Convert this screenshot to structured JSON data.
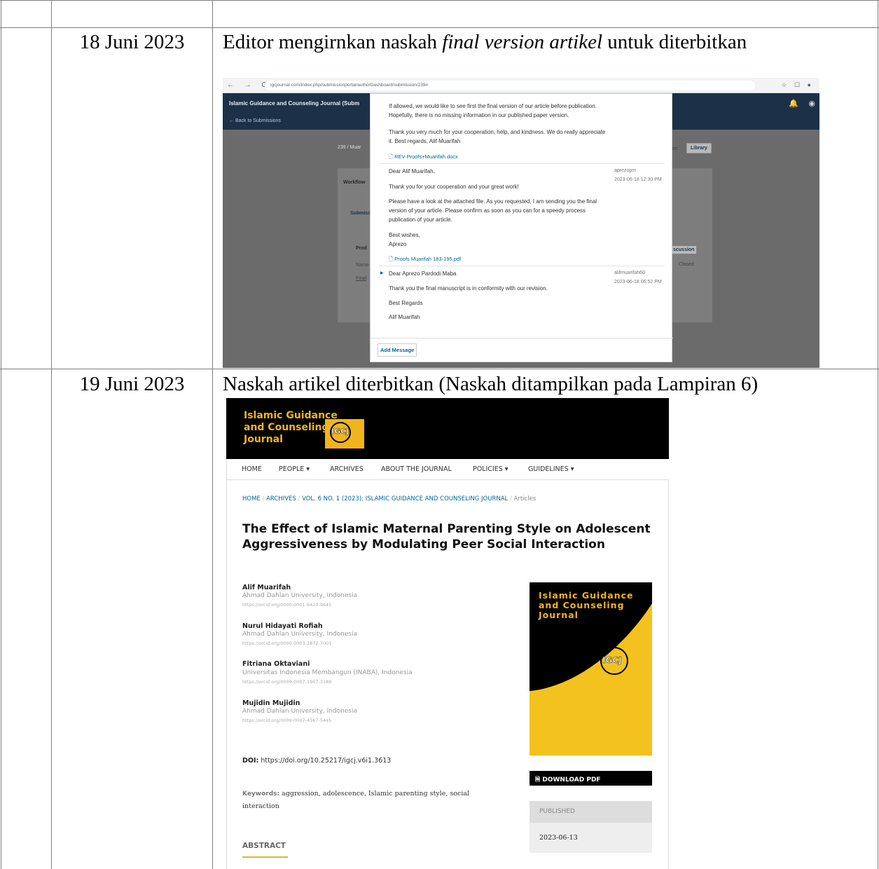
{
  "rows": [
    {
      "date": "18 Juni 2023",
      "desc_prefix": "Editor mengirnkan naskah ",
      "desc_italic": "final version artikel",
      "desc_suffix": " untuk diterbitkan"
    },
    {
      "date": "19 Juni 2023",
      "desc": "Naskah artikel diterbitkan (Naskah ditampilkan pada Lampiran 6)"
    }
  ],
  "screenshot1": {
    "browser": {
      "nav": "← → C",
      "url": "igcjournal.com/index.php/submissionportal/authorDashboard/submission/239#",
      "icons": "☆ ☐ ●"
    },
    "app_title": "Islamic Guidance and Counseling Journal (Subm",
    "back_link": "← Back to Submissions",
    "breadcrumb": "239 / Muar",
    "library_button": "Library",
    "background": {
      "workflow_tab": "Workflow",
      "submission_tab": "Submiss",
      "production_heading": "Prod",
      "name_col": "Name",
      "final_link": "Final",
      "discussion_button": "scussion",
      "closed_col": "Closed",
      "partial_word": "on"
    },
    "discussion": {
      "msg1_text": "If allowed, we would like to see first the final version of our article before publication. Hopefully, there is no missing information in our published paper version.",
      "msg1_thanks": "Thank you very much for your cooperation, help, and kindness. We do really appreciate it.   Best regards,   Alif Muarifah",
      "msg1_attachment": "REV Proofs+Muarifah.docx",
      "msg2_greeting": "Dear Alif Muarifah,",
      "msg2_line1": "Thank you for your cooperation and your great work!",
      "msg2_line2": "Please have a look at the attached file. As you requested, I am sending you the final version of your article. Please confirm as soon as you can for a speedy process publication of your article.",
      "msg2_closing": "Best wishes,",
      "msg2_name": "Aprezo",
      "msg2_attachment": "Proofs Muarifah 183-195.pdf",
      "msg2_author": "aprezopm",
      "msg2_date": "2023-06-18 12:30 PM",
      "msg3_greeting": "Dear Aprezo Pardodi Maba",
      "msg3_line1": "Thank you the final manuscript is in conformity with our revision.",
      "msg3_closing": "Best Regards",
      "msg3_name": "Alif Muarifah",
      "msg3_author": "alifmuarifah60",
      "msg3_date": "2023-06-18 06:52 PM",
      "add_message": "Add Message"
    }
  },
  "screenshot2": {
    "logo_text_1": "Islamic Guidance",
    "logo_text_2": "and Counseling",
    "logo_text_3": "Journal",
    "logo_badge": "IGCJ",
    "menu": [
      "HOME",
      "PEOPLE ▾",
      "ARCHIVES",
      "ABOUT THE JOURNAL",
      "POLICIES ▾",
      "GUIDELINES ▾"
    ],
    "breadcrumb": {
      "home": "HOME",
      "archives": "ARCHIVES",
      "issue": "VOL. 6 NO. 1 (2023): ISLAMIC GUIDANCE AND COUNSELING JOURNAL",
      "current": "Articles"
    },
    "title": "The Effect of Islamic Maternal Parenting Style on Adolescent Aggressiveness by Modulating Peer Social Interaction",
    "authors": [
      {
        "name": "Alif Muarifah",
        "affiliation": "Ahmad Dahlan University, Indonesia",
        "orcid": "https://orcid.org/0000-0001-6420-9645"
      },
      {
        "name": "Nurul Hidayati Rofiah",
        "affiliation": "Ahmad Dahlan University, Indonesia",
        "orcid": "https://orcid.org/0000-0003-2872-7001"
      },
      {
        "name": "Fitriana Oktaviani",
        "affiliation": "Universitas Indonesia Membangun (INABA), Indonesia",
        "orcid": "https://orcid.org/0009-0007-1907-3188"
      },
      {
        "name": "Mujidin Mujidin",
        "affiliation": "Ahmad Dahlan University, Indonesia",
        "orcid": "https://orcid.org/0009-0007-4367-5445"
      }
    ],
    "doi_label": "DOI:",
    "doi": "https://doi.org/10.25217/igcj.v6i1.3613",
    "keywords_label": "Keywords:",
    "keywords": "aggression, adolescence, Islamic parenting style, social interaction",
    "abstract_heading": "ABSTRACT",
    "cover": {
      "line1": "Islamic Guidance",
      "line2": "and Counseling",
      "line3": "Journal",
      "badge": "IGCJ",
      "colors": {
        "black": "#000000",
        "yellow": "#f4c21f"
      }
    },
    "download_pdf": "DOWNLOAD PDF",
    "published_label": "PUBLISHED",
    "published_date": "2023-06-13"
  }
}
